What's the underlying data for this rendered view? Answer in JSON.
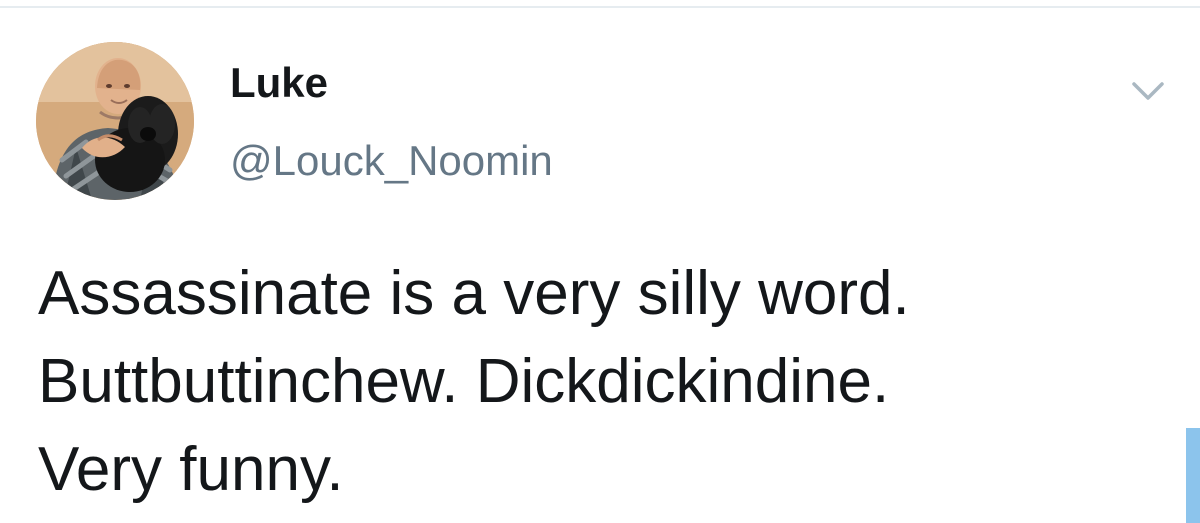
{
  "tweet": {
    "author": {
      "display_name": "Luke",
      "handle": "@Louck_Noomin"
    },
    "text_lines": [
      "Assassinate is a very silly word.",
      "Buttbuttinchew. Dickdickindine.",
      "Very funny."
    ],
    "icons": {
      "menu": "chevron-down-icon",
      "avatar": "profile-photo"
    }
  },
  "colors": {
    "primary_text": "#14171a",
    "secondary_text": "#657786",
    "divider": "#e6ecf0",
    "accent": "#8cc4ec"
  }
}
